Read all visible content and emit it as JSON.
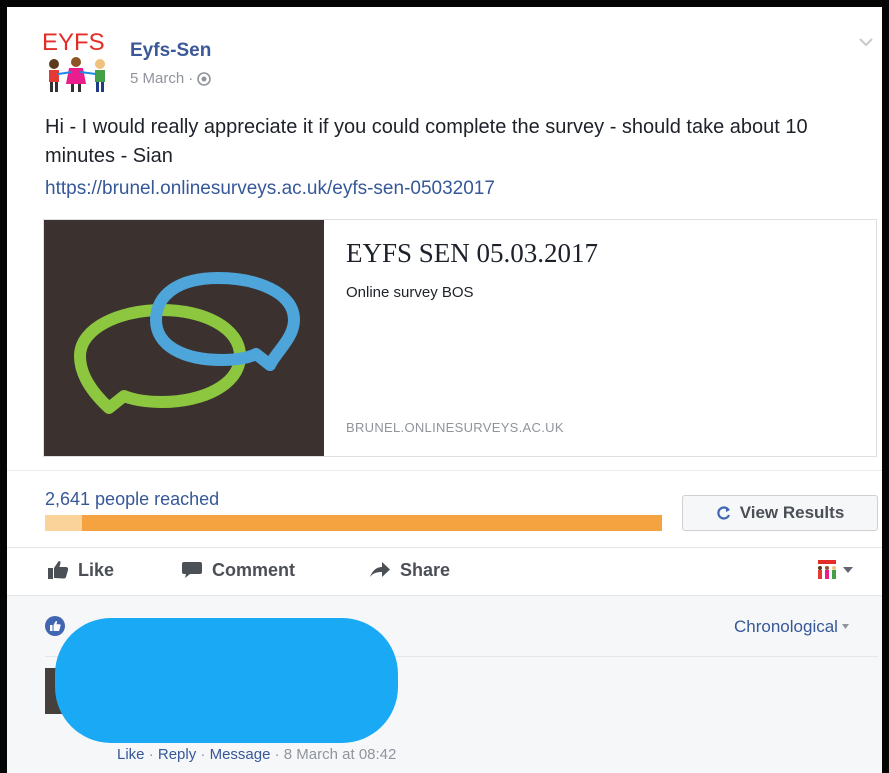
{
  "post": {
    "page_name": "Eyfs-Sen",
    "logo_text": "EYFS",
    "date": "5 March",
    "text": "Hi - I would really appreciate it if you could complete the survey - should take about 10 minutes - Sian",
    "link": "https://brunel.onlinesurveys.ac.uk/eyfs-sen-05032017"
  },
  "card": {
    "title": "EYFS SEN 05.03.2017",
    "subtitle": "Online survey BOS",
    "domain": "BRUNEL.ONLINESURVEYS.AC.UK"
  },
  "insights": {
    "reached": "2,641 people reached",
    "view_results_label": "View Results",
    "organic_fraction": 0.94,
    "colors": {
      "bar": "#f5a240",
      "bar_light": "#f9d39a",
      "link": "#365899"
    }
  },
  "actions": {
    "like": "Like",
    "comment": "Comment",
    "share": "Share"
  },
  "comments": {
    "sort_label": "Chronological",
    "comment_actions": {
      "like": "Like",
      "reply": "Reply",
      "message": "Message",
      "time": "8 March at 08:42"
    }
  }
}
